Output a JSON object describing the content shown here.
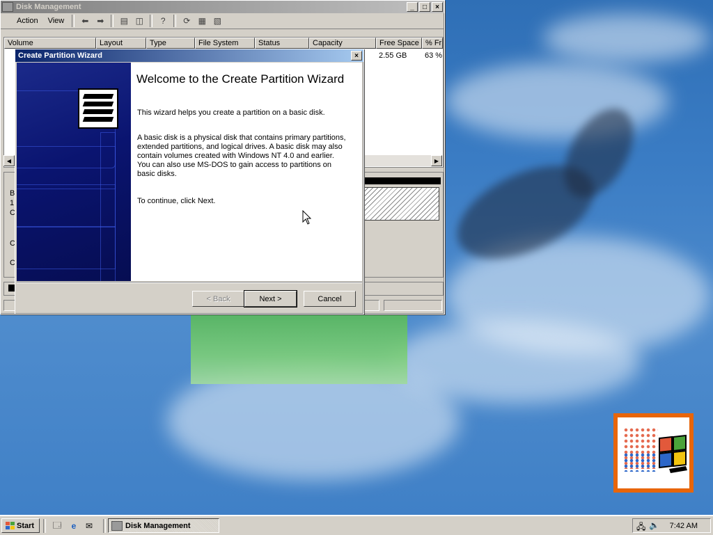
{
  "desktop": {
    "logo_colors": [
      "#e2593b",
      "#4aa33a",
      "#2d67c9",
      "#f2c40f"
    ]
  },
  "disk_management": {
    "title": "Disk Management",
    "menu": [
      "Action",
      "View"
    ],
    "columns": [
      "Volume",
      "Layout",
      "Type",
      "File System",
      "Status",
      "Capacity",
      "Free Space",
      "% Fr"
    ],
    "row": {
      "free_space": "2.55 GB",
      "percent": "63 %"
    },
    "left_letters": [
      "B",
      "1",
      "C",
      "C",
      "C"
    ]
  },
  "wizard": {
    "title": "Create Partition Wizard",
    "heading": "Welcome to the Create Partition Wizard",
    "intro": "This wizard helps you create a partition on a basic disk.",
    "body": "A basic disk is a physical disk that contains primary partitions, extended partitions, and logical drives. A basic disk may also contain volumes created with Windows NT 4.0 and earlier. You can also use MS-DOS to gain access to partitions on basic disks.",
    "continue": "To continue, click Next.",
    "back_label": "< Back",
    "next_label": "Next >",
    "cancel_label": "Cancel"
  },
  "taskbar": {
    "start_label": "Start",
    "task_label": "Disk Management",
    "clock": "7:42 AM"
  },
  "icons": {
    "close": "close-icon",
    "minimize": "minimize-icon",
    "maximize": "maximize-icon"
  }
}
